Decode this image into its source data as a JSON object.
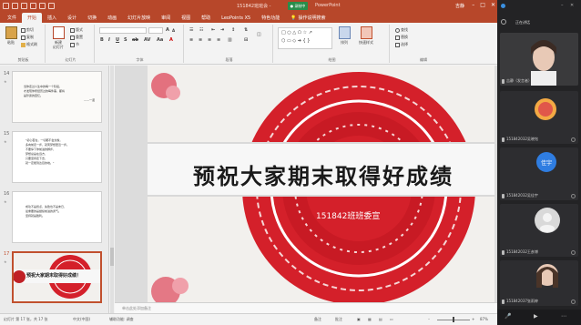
{
  "window": {
    "title": "151842班班会 -",
    "recording": "● 录制中",
    "app_name": "PowerPoint",
    "user": "吉静"
  },
  "tabs": [
    "文件",
    "开始",
    "插入",
    "设计",
    "切换",
    "动画",
    "幻灯片放映",
    "审阅",
    "视图",
    "帮助",
    "LeoPoints X5",
    "特色功能"
  ],
  "tell_me": "操作说明搜索",
  "ribbon": {
    "paste": "粘贴",
    "clipboard_items": [
      "剪切",
      "复制",
      "格式刷"
    ],
    "clipboard": "剪贴板",
    "new_slide": "新建\n幻灯片",
    "slide_items": [
      "版式",
      "重置",
      "节"
    ],
    "slides": "幻灯片",
    "font": "字体",
    "paragraph": "段落",
    "drawing": "绘图",
    "editing": "编辑",
    "arrange": "排列",
    "quick_styles": "快速样式",
    "editing_items": [
      "查找",
      "替换",
      "选择"
    ]
  },
  "thumbnails": [
    {
      "num": "14",
      "lines": [
        "当你走过人生中的每一个阶段，",
        "才发现你所经历过的每件事，都将",
        "是珍贵的回忆。",
        "——一诺"
      ]
    },
    {
      "num": "15",
      "lines": [
        "\"初心若在，一切都不会太晚，",
        "多向前走一步，就离梦想更近一步。",
        "不要停下你前进的脚步，",
        "梦想总是在远方，",
        "只要坚持走下去，",
        "就一定能到达目的地。\""
      ]
    },
    {
      "num": "16",
      "lines": [
        "成功不是终点，失败也不是末日，",
        "最重要的是继续前进的勇气。",
        "坚持就是胜利。"
      ]
    },
    {
      "num": "17",
      "lines": [
        "预祝大家期末取得好成绩！"
      ]
    }
  ],
  "slide": {
    "title": "预祝大家期末取得好成绩",
    "subtitle": "151842班班委宣"
  },
  "notes_placeholder": "单击此处添加备注",
  "status": {
    "slide_info": "幻灯片 第 17 张，共 17 张",
    "language": "中文(中国)",
    "accessibility": "辅助功能: 调查",
    "notes": "备注",
    "comments": "批注",
    "zoom": "87%"
  },
  "side": {
    "user": "吉静",
    "speaker": "吉静（发言者）",
    "status_label": "正在讲话",
    "participants": [
      {
        "name": "吉静（发言者）"
      },
      {
        "name": "151842032吴晓铭"
      },
      {
        "name": "151842032吴佳宇",
        "initials": "佳宇"
      },
      {
        "name": "151842032王彦博"
      },
      {
        "name": "151842037张雨婷"
      }
    ]
  },
  "colors": {
    "ppt_red": "#b7472a",
    "slide_red": "#d4202a"
  }
}
